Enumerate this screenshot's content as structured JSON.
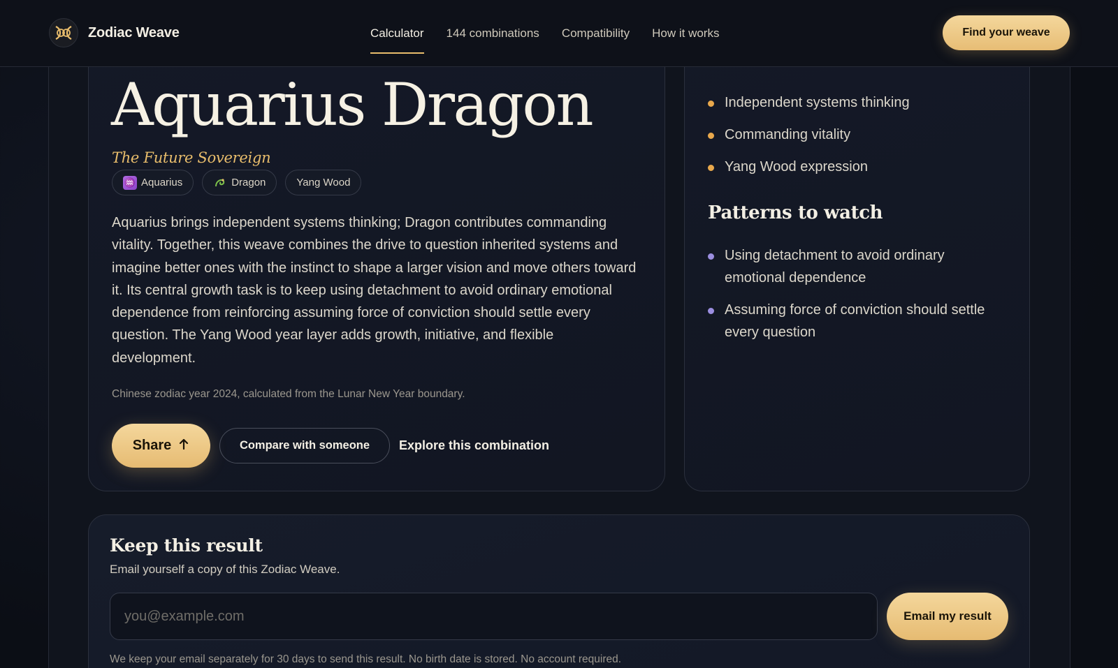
{
  "brand": {
    "name": "Zodiac Weave"
  },
  "nav": {
    "items": [
      {
        "label": "Calculator",
        "active": true
      },
      {
        "label": "144 combinations",
        "active": false
      },
      {
        "label": "Compatibility",
        "active": false
      },
      {
        "label": "How it works",
        "active": false
      }
    ],
    "cta_label": "Find your weave"
  },
  "result": {
    "title": "Aquarius Dragon",
    "subtitle": "The Future Sovereign",
    "chips": [
      {
        "label": "Aquarius",
        "icon": "aquarius-icon"
      },
      {
        "label": "Dragon",
        "icon": "dragon-icon"
      },
      {
        "label": "Yang Wood",
        "icon": ""
      }
    ],
    "description": "Aquarius brings independent systems thinking; Dragon contributes commanding vitality. Together, this weave combines the drive to question inherited systems and imagine better ones with the instinct to shape a larger vision and move others toward it. Its central growth task is to keep using detachment to avoid ordinary emotional dependence from reinforcing assuming force of conviction should settle every question. The Yang Wood year layer adds growth, initiative, and flexible development.",
    "note": "Chinese zodiac year 2024, calculated from the Lunar New Year boundary.",
    "share_label": "Share",
    "compare_label": "Compare with someone",
    "explore_label": "Explore this combination"
  },
  "side": {
    "strengths": [
      "Independent systems thinking",
      "Commanding vitality",
      "Yang Wood expression"
    ],
    "patterns_heading": "Patterns to watch",
    "patterns": [
      "Using detachment to avoid ordinary emotional dependence",
      "Assuming force of conviction should settle every question"
    ]
  },
  "keep": {
    "title": "Keep this result",
    "subtitle": "Email yourself a copy of this Zodiac Weave.",
    "email_placeholder": "you@example.com",
    "email_value": "",
    "button_label": "Email my result",
    "note": "We keep your email separately for 30 days to send this result. No birth date is stored. No account required."
  },
  "colors": {
    "accent_gold": "#e9bd6c",
    "strength_bullet": "#e9a84c",
    "pattern_bullet": "#9b8ee0",
    "background": "#0d1018"
  }
}
